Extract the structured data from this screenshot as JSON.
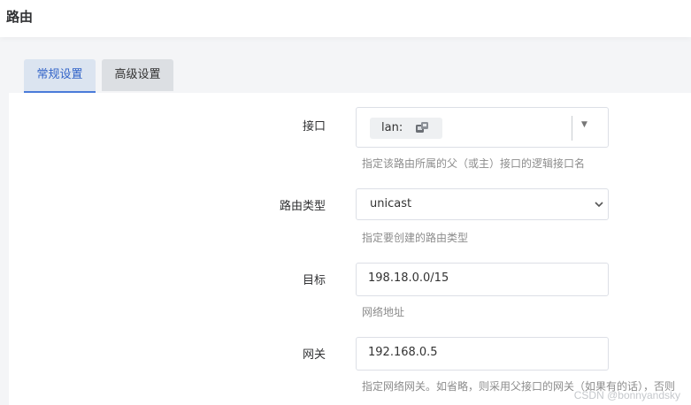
{
  "page": {
    "title": "路由"
  },
  "tabs": [
    {
      "label": "常规设置",
      "active": true
    },
    {
      "label": "高级设置",
      "active": false
    }
  ],
  "form": {
    "interface": {
      "label": "接口",
      "chip_text": "lan:",
      "chip_icon": "network-port-icon",
      "help": "指定该路由所属的父（或主）接口的逻辑接口名"
    },
    "route_type": {
      "label": "路由类型",
      "value": "unicast",
      "help": "指定要创建的路由类型"
    },
    "target": {
      "label": "目标",
      "value": "198.18.0.0/15",
      "help": "网络地址"
    },
    "gateway": {
      "label": "网关",
      "value": "192.168.0.5",
      "help": "指定网络网关。如省略，则采用父接口的网关（如果有的话），否则"
    }
  },
  "watermark": "CSDN @bonnyandsky",
  "colors": {
    "accent": "#4a7bd9",
    "tab_active_bg": "#dbe4f0"
  }
}
